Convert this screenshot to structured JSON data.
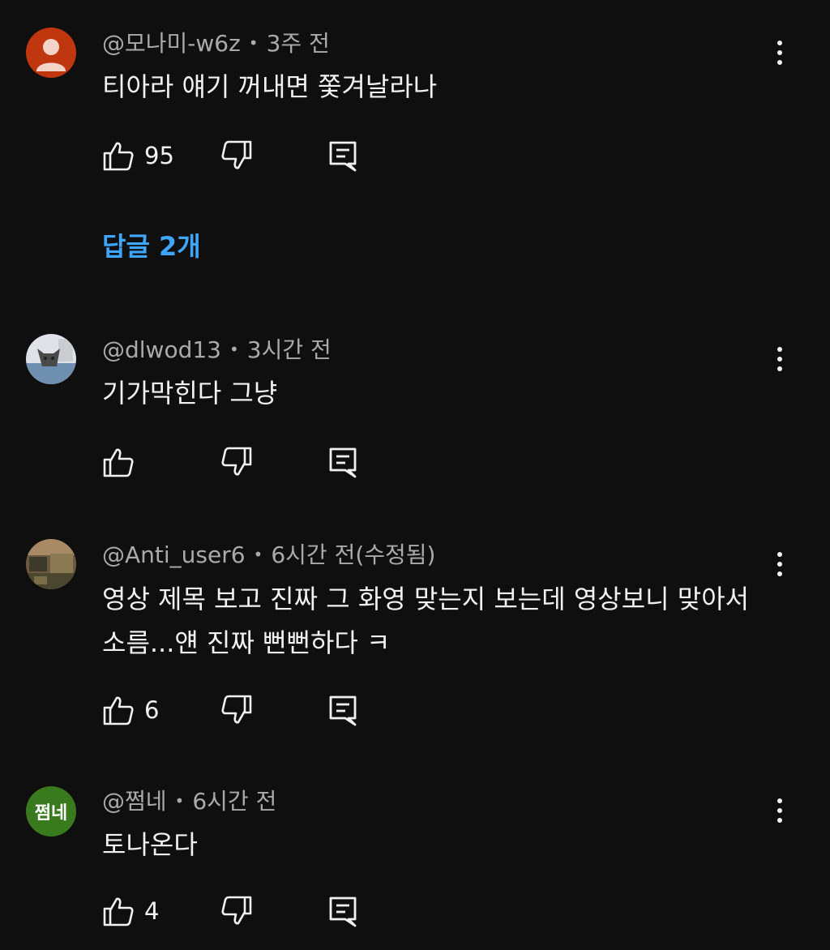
{
  "comments": [
    {
      "handle": "@모나미-w6z",
      "time": "3주 전",
      "text": "티아라 얘기 꺼내면 쫓겨날라나",
      "likes": "95",
      "avatar_icon": "default-person-icon",
      "avatar_color": "#c0370f",
      "replies_label": "답글 2개"
    },
    {
      "handle": "@dlwod13",
      "time": "3시간 전",
      "text": "기가막힌다 그냥",
      "likes": "",
      "avatar_icon": "cat-photo-icon"
    },
    {
      "handle": "@Anti_user6",
      "time": "6시간 전(수정됨)",
      "text": "영상 제목 보고 진짜 그 화영 맞는지 보는데 영상보니 맞아서 소름...얜 진짜 뻔뻔하다 ㅋ",
      "likes": "6",
      "avatar_icon": "photo-avatar-icon"
    },
    {
      "handle": "@쩜네",
      "time": "6시간 전",
      "text": "토나온다",
      "likes": "4",
      "avatar_text": "쩜네",
      "avatar_color": "#3a7a1e"
    }
  ],
  "colors": {
    "background": "#0f0f0f",
    "link": "#3ea6ff",
    "meta": "#aaaaaa"
  }
}
